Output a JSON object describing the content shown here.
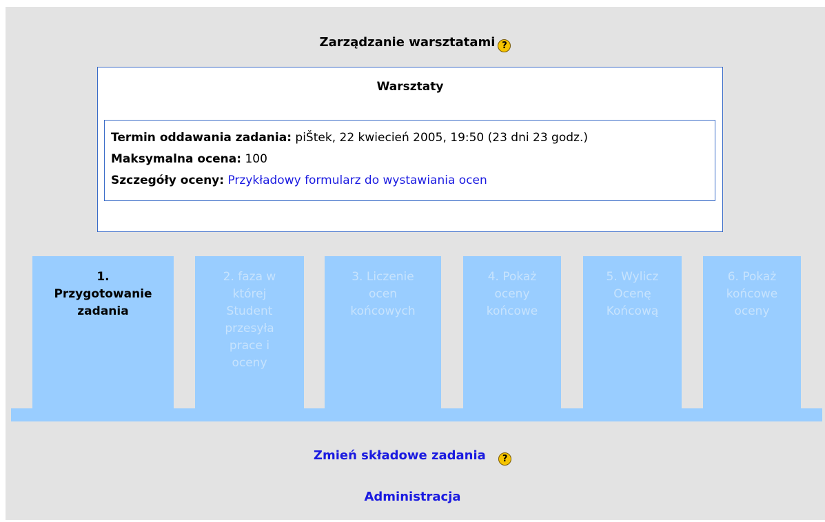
{
  "heading": "Zarządzanie warsztatami",
  "help_glyph": "?",
  "infobox": {
    "title": "Warsztaty",
    "deadline_label": "Termin oddawania zadania:",
    "deadline_value": "piŠtek, 22 kwiecień 2005, 19:50 (23 dni 23 godz.)",
    "max_label": "Maksymalna ocena:",
    "max_value": "100",
    "details_label": "Szczegóły oceny:",
    "details_link": "Przykładowy formularz do wystawiania ocen"
  },
  "tabs": [
    {
      "lines": [
        "1.",
        "Przygotowanie",
        "zadania"
      ],
      "active": true
    },
    {
      "lines": [
        "2. faza w",
        "której",
        "Student",
        "przesyła",
        "prace i",
        "oceny"
      ],
      "active": false
    },
    {
      "lines": [
        "3. Liczenie",
        "ocen",
        "końcowych"
      ],
      "active": false
    },
    {
      "lines": [
        "4. Pokaż",
        "oceny",
        "końcowe"
      ],
      "active": false
    },
    {
      "lines": [
        "5. Wylicz",
        "Ocenę",
        "Końcową"
      ],
      "active": false
    },
    {
      "lines": [
        "6. Pokaż",
        "końcowe",
        "oceny"
      ],
      "active": false
    }
  ],
  "links": {
    "change_components": "Zmień składowe zadania",
    "administration": "Administracja"
  },
  "colors": {
    "tab_bg": "#99cdff",
    "tab_inactive_text": "#c7e3fd",
    "link": "#1a1ae0",
    "panel_bg": "#e3e3e3",
    "border": "#3a6cc8"
  }
}
